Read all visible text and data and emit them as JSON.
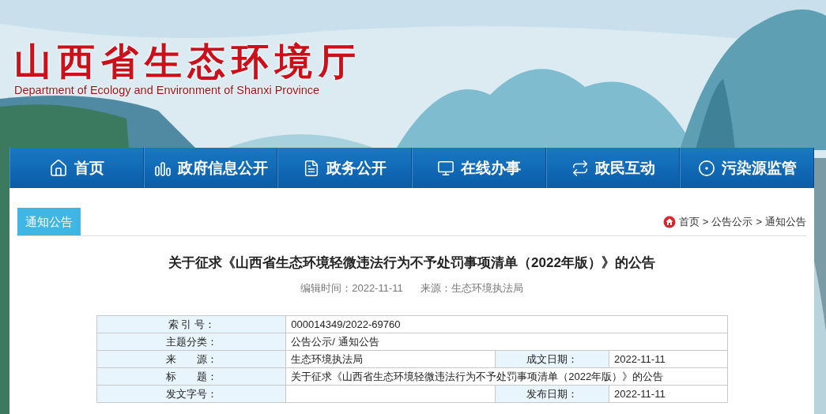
{
  "header": {
    "title": "山西省生态环境厅",
    "subtitle": "Department of Ecology and Environment of Shanxi Province"
  },
  "nav": [
    {
      "label": "首页"
    },
    {
      "label": "政府信息公开"
    },
    {
      "label": "政务公开"
    },
    {
      "label": "在线办事"
    },
    {
      "label": "政民互动"
    },
    {
      "label": "污染源监管"
    }
  ],
  "section_tab": "通知公告",
  "breadcrumb": [
    "首页",
    "公告公示",
    "通知公告"
  ],
  "breadcrumb_separator": ">",
  "article": {
    "title": "关于征求《山西省生态环境轻微违法行为不予处罚事项清单（2022年版）》的公告",
    "meta": [
      "编辑时间：2022-11-11",
      "来源：生态环境执法局"
    ]
  },
  "table": {
    "rows": [
      {
        "cells": [
          {
            "kind": "label",
            "text": "索 引 号："
          },
          {
            "kind": "value",
            "text": "000014349/2022-69760",
            "colspan": 3
          }
        ]
      },
      {
        "cells": [
          {
            "kind": "label",
            "text": "主题分类："
          },
          {
            "kind": "value",
            "text": "公告公示/ 通知公告",
            "colspan": 3
          }
        ]
      },
      {
        "cells": [
          {
            "kind": "label",
            "text": "来　　源："
          },
          {
            "kind": "value",
            "text": "生态环境执法局"
          },
          {
            "kind": "label",
            "text": "成文日期："
          },
          {
            "kind": "value",
            "text": "2022-11-11"
          }
        ]
      },
      {
        "cells": [
          {
            "kind": "label",
            "text": "标　　题："
          },
          {
            "kind": "value",
            "colspan": 3,
            "text": "关于征求《山西省生态环境轻微违法行为不予处罚事项清单（2022年版）》的公告"
          }
        ]
      },
      {
        "cells": [
          {
            "kind": "label",
            "text": "发文字号："
          },
          {
            "kind": "value"
          },
          {
            "kind": "label",
            "text": "发布日期："
          },
          {
            "kind": "value",
            "text": "2022-11-11"
          }
        ]
      }
    ]
  }
}
